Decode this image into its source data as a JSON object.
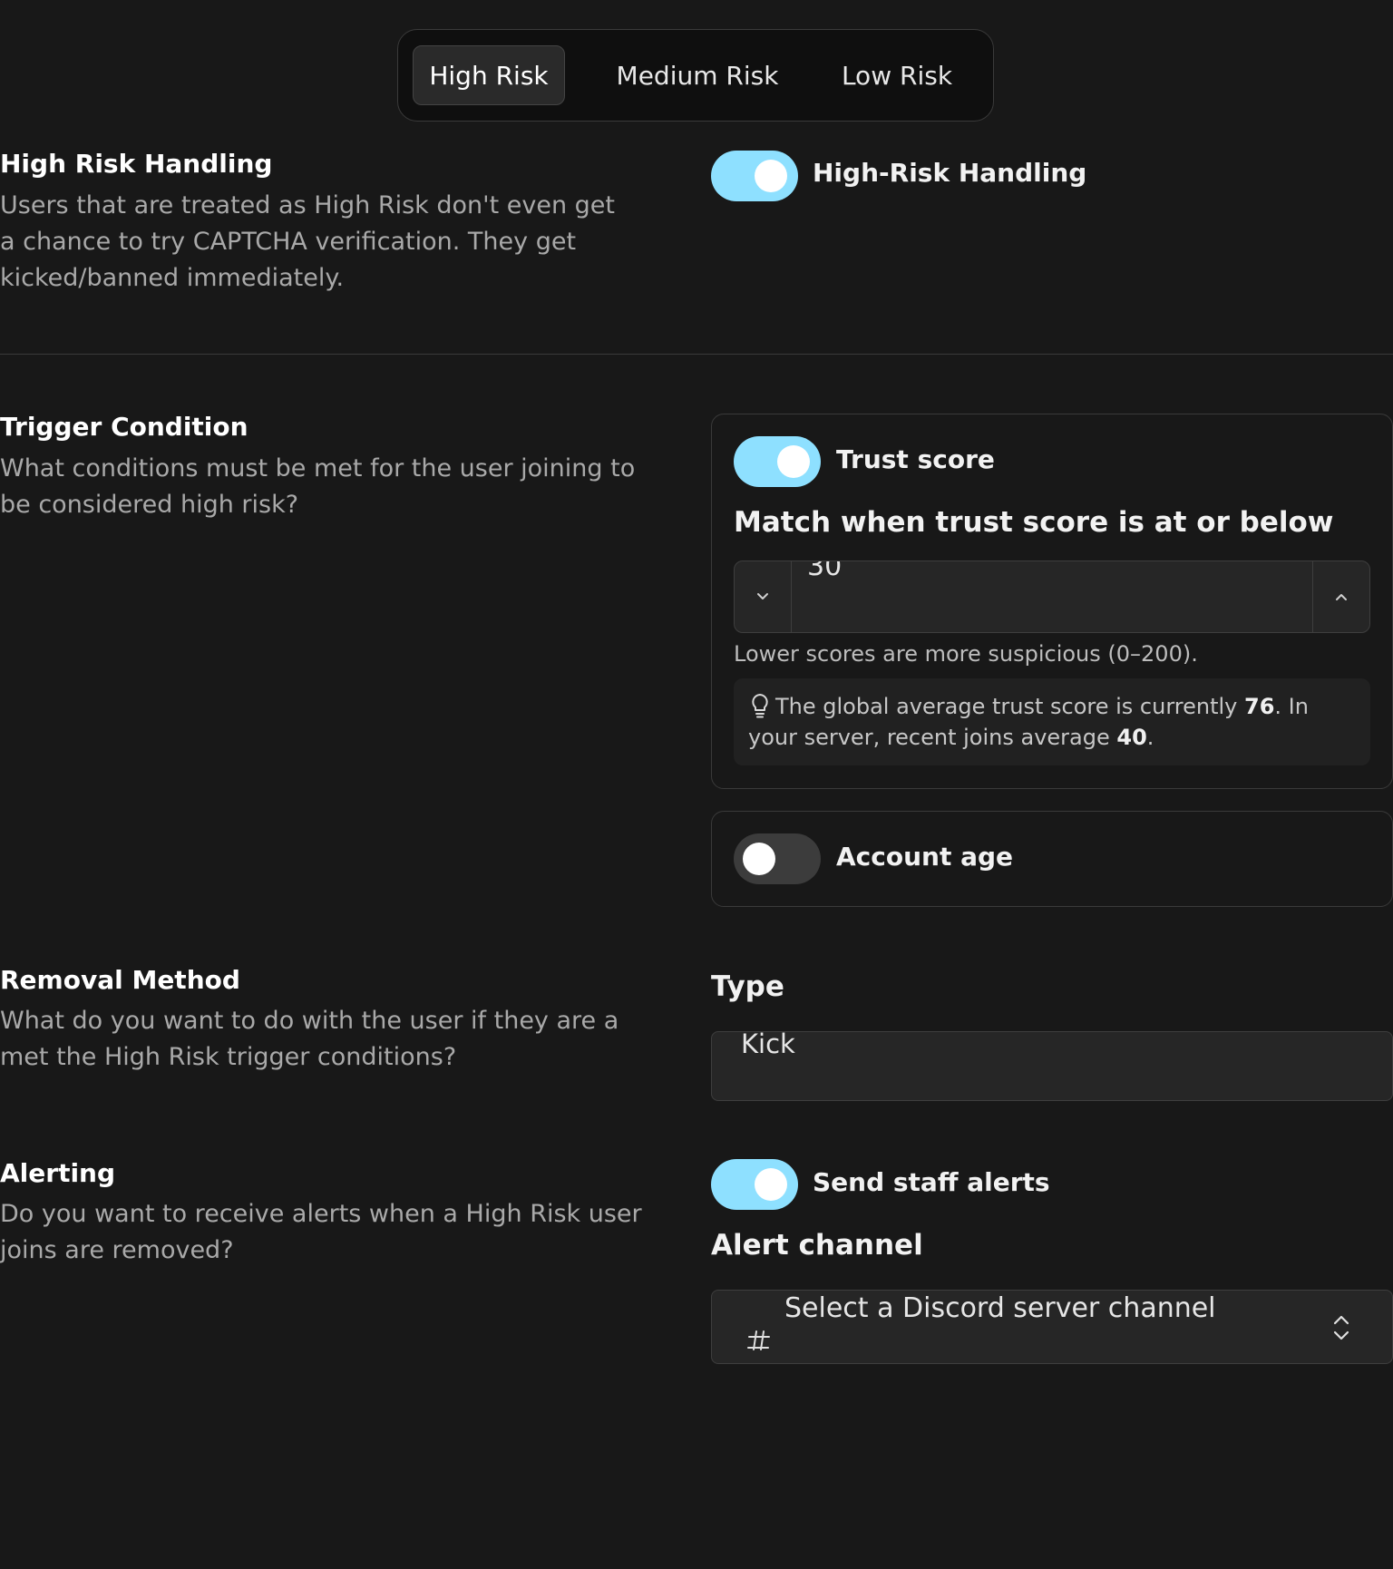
{
  "tabs": [
    {
      "label": "High Risk",
      "active": true
    },
    {
      "label": "Medium Risk",
      "active": false
    },
    {
      "label": "Low Risk",
      "active": false
    }
  ],
  "high_risk_handling": {
    "title": "High Risk Handling",
    "description": "Users that are treated as High Risk don't even get a chance to try CAPTCHA verification. They get kicked/banned immediately.",
    "toggle_label": "High-Risk Handling",
    "enabled": true
  },
  "trigger_condition": {
    "title": "Trigger Condition",
    "description": "What conditions must be met for the user joining to be considered high risk?",
    "trust_score": {
      "toggle_label": "Trust score",
      "enabled": true,
      "field_label": "Match when trust score is at or below",
      "value": "30",
      "hint": "Lower scores are more suspicious (0–200).",
      "tip_prefix": "The global average trust score is currently ",
      "global_average": "76",
      "tip_middle": ". In your server, recent joins average ",
      "recent_average": "40",
      "tip_suffix": "."
    },
    "account_age": {
      "toggle_label": "Account age",
      "enabled": false
    }
  },
  "removal_method": {
    "title": "Removal Method",
    "description": "What do you want to do with the user if they are a met the High Risk trigger conditions?",
    "type_label": "Type",
    "type_value": "Kick"
  },
  "alerting": {
    "title": "Alerting",
    "description": "Do you want to receive alerts when a High Risk user joins are removed?",
    "toggle_label": "Send staff alerts",
    "enabled": true,
    "channel_label": "Alert channel",
    "channel_placeholder": "Select a Discord server channel"
  },
  "colors": {
    "background": "#181818",
    "toggle_on": "#8ee0ff",
    "toggle_off": "#3c3c3c"
  }
}
